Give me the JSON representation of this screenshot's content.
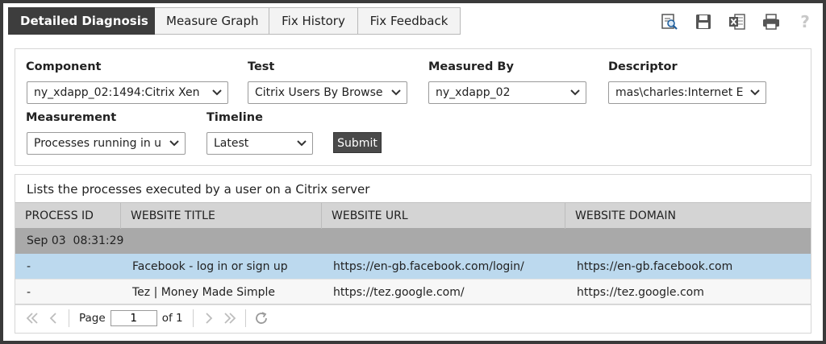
{
  "tabs": [
    {
      "label": "Detailed Diagnosis",
      "active": true
    },
    {
      "label": "Measure Graph",
      "active": false
    },
    {
      "label": "Fix History",
      "active": false
    },
    {
      "label": "Fix Feedback",
      "active": false
    }
  ],
  "toolbar": {
    "icons": [
      "search-report-icon",
      "save-icon",
      "excel-export-icon",
      "print-icon",
      "help-icon"
    ],
    "help_symbol": "?"
  },
  "filters": {
    "component": {
      "label": "Component",
      "value": "ny_xdapp_02:1494:Citrix Xen"
    },
    "test": {
      "label": "Test",
      "value": "Citrix Users By Browse"
    },
    "measured_by": {
      "label": "Measured By",
      "value": "ny_xdapp_02"
    },
    "descriptor": {
      "label": "Descriptor",
      "value": "mas\\charles:Internet E"
    },
    "measurement": {
      "label": "Measurement",
      "value": "Processes running in u"
    },
    "timeline": {
      "label": "Timeline",
      "value": "Latest"
    },
    "submit_label": "Submit"
  },
  "results": {
    "caption": "Lists the processes executed by a user on a Citrix server",
    "columns": [
      "PROCESS ID",
      "WEBSITE TITLE",
      "WEBSITE URL",
      "WEBSITE DOMAIN"
    ],
    "group_label": "Sep 03  08:31:29",
    "rows": [
      {
        "process_id": "-",
        "title": "Facebook - log in or sign up",
        "url": "https://en-gb.facebook.com/login/",
        "domain": "https://en-gb.facebook.com"
      },
      {
        "process_id": "-",
        "title": "Tez | Money Made Simple",
        "url": "https://tez.google.com/",
        "domain": "https://tez.google.com"
      }
    ]
  },
  "pager": {
    "page_label": "Page",
    "current_page": "1",
    "of_label": "of 1"
  },
  "colors": {
    "active_tab_bg": "#3d3d3d",
    "selected_row": "#bcd9ee",
    "group_row": "#a9a9a9",
    "header_row": "#d4d4d4"
  }
}
